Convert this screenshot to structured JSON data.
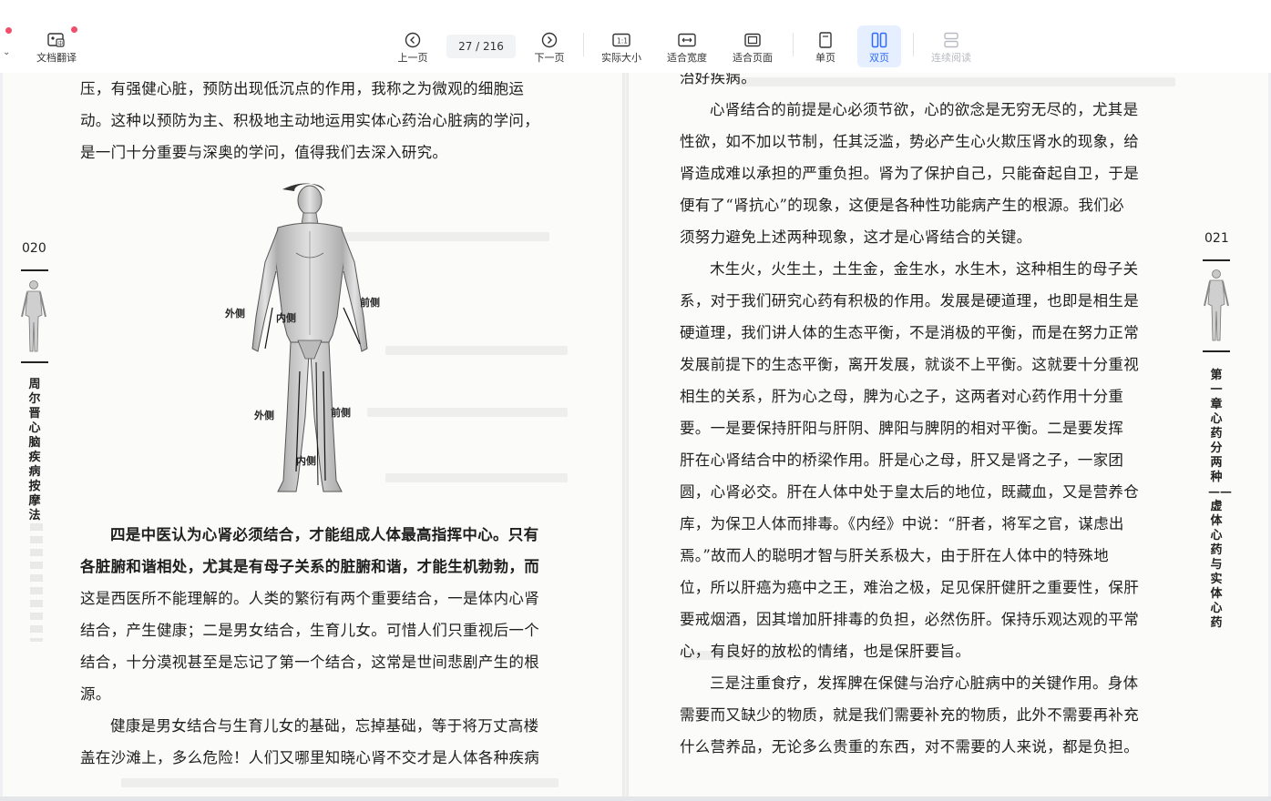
{
  "toolbar": {
    "translate_label": "文档翻译",
    "prev_label": "上一页",
    "page_indicator": "27 / 216",
    "next_label": "下一页",
    "actual_size_label": "实际大小",
    "fit_width_label": "适合宽度",
    "fit_page_label": "适合页面",
    "single_label": "单页",
    "double_label": "双页",
    "continuous_label": "连续阅读"
  },
  "left_page": {
    "page_number": "020",
    "side_title": "周尔晋心脑疾病按摩法",
    "paragraphs": [
      {
        "text": "压，有强健心脏，预防出现低沉点的作用，我称之为微观的细胞运",
        "bold": false
      },
      {
        "text": "动。这种以预防为主、积极地主动地运用实体心药治心脏病的学问，",
        "bold": false
      },
      {
        "text": "是一门十分重要与深奥的学问，值得我们去深入研究。",
        "bold": false
      }
    ],
    "figure_labels": {
      "outer_left_top": "外侧",
      "inner_top": "内侧",
      "front_top": "前侧",
      "outer_left_bottom": "外侧",
      "front_bottom": "前侧",
      "inner_bottom": "内侧"
    },
    "paragraphs2": [
      {
        "text": "四是中医认为心肾必须结合，才能组成人体最高指挥中心。只有",
        "bold": true
      },
      {
        "text": "各脏腑和谐相处，尤其是有母子关系的脏腑和谐，才能生机勃勃，而",
        "bold": true
      },
      {
        "text": "这是西医所不能理解的。人类的繁衍有两个重要结合，一是体内心肾",
        "bold": false
      },
      {
        "text": "结合，产生健康；二是男女结合，生育儿女。可惜人们只重视后一个",
        "bold": false
      },
      {
        "text": "结合，十分漠视甚至是忘记了第一个结合，这常是世间悲剧产生的根",
        "bold": false
      },
      {
        "text": "源。",
        "bold": false
      },
      {
        "text": "健康是男女结合与生育儿女的基础，忘掉基础，等于将万丈高楼",
        "bold": false
      },
      {
        "text": "盖在沙滩上，多么危险！人们又哪里知晓心肾不交才是人体各种疾病",
        "bold": false
      }
    ]
  },
  "right_page": {
    "page_number": "021",
    "side_title": "第一章 心药分两种——虚体心药与实体心药",
    "lines": [
      "治好疾病。",
      "心肾结合的前提是心必须节欲，心的欲念是无穷无尽的，尤其是",
      "性欲，如不加以节制，任其泛滥，势必产生心火欺压肾水的现象，给",
      "肾造成难以承担的严重负担。肾为了保护自己，只能奋起自卫，于是",
      "便有了“肾抗心”的现象，这便是各种性功能病产生的根源。我们必",
      "须努力避免上述两种现象，这才是心肾结合的关键。",
      "木生火，火生土，土生金，金生水，水生木，这种相生的母子关",
      "系，对于我们研究心药有积极的作用。发展是硬道理，也即是相生是",
      "硬道理，我们讲人体的生态平衡，不是消极的平衡，而是在努力正常",
      "发展前提下的生态平衡，离开发展，就谈不上平衡。这就要十分重视",
      "相生的关系，肝为心之母，脾为心之子，这两者对心药作用十分重",
      "要。一是要保持肝阳与肝阴、脾阳与脾阴的相对平衡。二是要发挥",
      "肝在心肾结合中的桥梁作用。肝是心之母，肝又是肾之子，一家团",
      "圆，心肾必交。肝在人体中处于皇太后的地位，既藏血，又是营养仓",
      "库，为保卫人体而排毒。《内经》中说：“肝者，将军之官，谋虑出",
      "焉。”故而人的聪明才智与肝关系极大，由于肝在人体中的特殊地",
      "位，所以肝癌为癌中之王，难治之极，足见保肝健肝之重要性，保肝",
      "要戒烟酒，因其增加肝排毒的负担，必然伤肝。保持乐观达观的平常",
      "心，有良好的放松的情绪，也是保肝要旨。",
      "三是注重食疗，发挥脾在保健与治疗心脏病中的关键作用。身体",
      "需要而又缺少的物质，就是我们需要补充的物质，此外不需要再补充",
      "什么营养品，无论多么贵重的东西，对不需要的人来说，都是负担。"
    ]
  }
}
